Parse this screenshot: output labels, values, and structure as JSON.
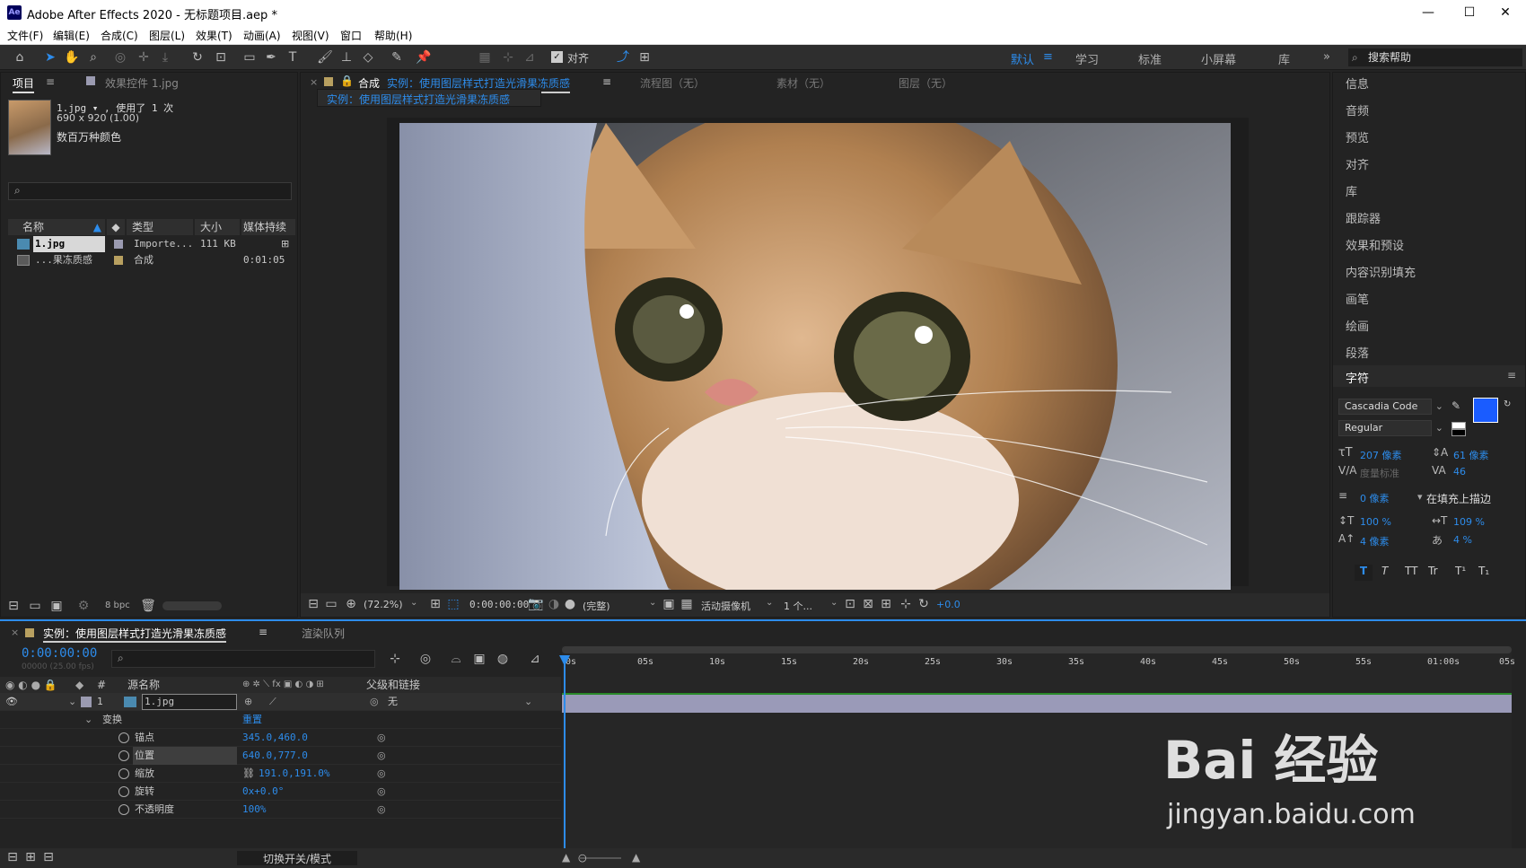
{
  "window": {
    "title": "Adobe After Effects 2020 - 无标题项目.aep *",
    "icon": "Ae",
    "minimize": "—",
    "maximize": "☐",
    "close": "✕"
  },
  "menu": [
    "文件(F)",
    "编辑(E)",
    "合成(C)",
    "图层(L)",
    "效果(T)",
    "动画(A)",
    "视图(V)",
    "窗口",
    "帮助(H)"
  ],
  "toolbar": {
    "snap_label": "对齐",
    "workspaces": [
      "默认",
      "学习",
      "标准",
      "小屏幕",
      "库"
    ],
    "active_workspace": "默认",
    "more": "»",
    "search_placeholder": "搜索帮助"
  },
  "project_panel": {
    "tab_project": "项目",
    "tab_effects": "效果控件 1.jpg",
    "asset_name": "1.jpg ▾ , 使用了 1 次",
    "asset_dims": "690 x 920 (1.00)",
    "asset_colors": "数百万种颜色",
    "columns": [
      "名称",
      "类型",
      "大小",
      "媒体持续"
    ],
    "rows": [
      {
        "name": "1.jpg",
        "type": "Importe...",
        "size": "111 KB",
        "duration": ""
      },
      {
        "name": "...果冻质感",
        "type": "合成",
        "size": "",
        "duration": "0:01:05"
      }
    ],
    "bpc": "8 bpc"
  },
  "viewer": {
    "tab_label": "合成",
    "tab_comp_name": "实例：使用图层样式打造光滑果冻质感",
    "other_tabs": [
      "流程图（无）",
      "素材（无）",
      "图层（无）"
    ],
    "breadcrumb": "实例：使用图层样式打造光滑果冻质感",
    "zoom": "(72.2%)",
    "timecode": "0:00:00:00",
    "resolution": "(完整)",
    "camera": "活动摄像机",
    "views": "1 个...",
    "exposure": "+0.0"
  },
  "right_panel": {
    "items": [
      "信息",
      "音频",
      "预览",
      "对齐",
      "库",
      "跟踪器",
      "效果和预设",
      "内容识别填充",
      "画笔",
      "绘画",
      "段落"
    ],
    "character_title": "字符",
    "font": "Cascadia Code",
    "style": "Regular",
    "fill_color": "#1a5cff",
    "font_size": "207 像素",
    "leading": "61 像素",
    "kerning": "度量标准",
    "tracking": "46",
    "stroke_width": "0 像素",
    "stroke_mode": "在填充上描边",
    "vscale": "100 %",
    "hscale": "109 %",
    "baseline": "4 像素",
    "tsume": "4 %",
    "text_styles": [
      "T",
      "T",
      "TT",
      "Tr",
      "T¹",
      "T₁"
    ]
  },
  "timeline": {
    "comp_tab": "实例：使用图层样式打造光滑果冻质感",
    "render_tab": "渲染队列",
    "timecode": "0:00:00:00",
    "timecode_sub": "00000 (25.00 fps)",
    "headers": {
      "num": "#",
      "source": "源名称",
      "parent": "父级和链接"
    },
    "layer": {
      "num": "1",
      "name": "1.jpg",
      "parent": "无"
    },
    "transform_label": "变换",
    "reset": "重置",
    "props": [
      {
        "name": "锚点",
        "value": "345.0,460.0"
      },
      {
        "name": "位置",
        "value": "640.0,777.0"
      },
      {
        "name": "缩放",
        "value": "191.0,191.0%"
      },
      {
        "name": "旋转",
        "value": "0x+0.0°"
      },
      {
        "name": "不透明度",
        "value": "100%"
      }
    ],
    "ruler": [
      "0s",
      "05s",
      "10s",
      "15s",
      "20s",
      "25s",
      "30s",
      "35s",
      "40s",
      "45s",
      "50s",
      "55s",
      "01:00s",
      "05s"
    ],
    "footer_toggle": "切换开关/模式"
  },
  "watermark": {
    "brand": "Bai 经验",
    "url": "jingyan.baidu.com"
  }
}
